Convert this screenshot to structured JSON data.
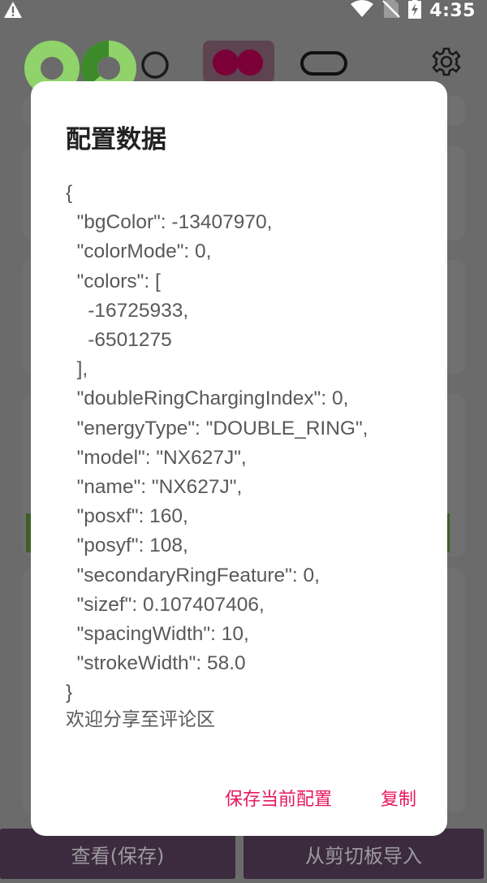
{
  "status_bar": {
    "time": "4:35",
    "icons": [
      "warning-icon",
      "wifi-icon",
      "no-sim-icon",
      "battery-charging-icon"
    ]
  },
  "toolbar": {
    "icons": [
      "double-ring-green-icon",
      "single-ring-icon",
      "double-dot-icon",
      "pill-icon",
      "gear-icon"
    ],
    "colors": {
      "ring_light": "#8fd36a",
      "ring_dark": "#3d8a2a",
      "active": "#7a0037"
    }
  },
  "dialog": {
    "title": "配置数据",
    "json_text": "{\n  \"bgColor\": -13407970,\n  \"colorMode\": 0,\n  \"colors\": [\n    -16725933,\n    -6501275\n  ],\n  \"doubleRingChargingIndex\": 0,\n  \"energyType\": \"DOUBLE_RING\",\n  \"model\": \"NX627J\",\n  \"name\": \"NX627J\",\n  \"posxf\": 160,\n  \"posyf\": 108,\n  \"secondaryRingFeature\": 0,\n  \"sizef\": 0.107407406,\n  \"spacingWidth\": 10,\n  \"strokeWidth\": 58.0\n}",
    "note": "欢迎分享至评论区",
    "save_button": "保存当前配置",
    "copy_button": "复制",
    "accent": "#e6195f"
  },
  "bottom_buttons": {
    "view_save": "查看(保存)",
    "import_clipboard": "从剪切板导入"
  }
}
